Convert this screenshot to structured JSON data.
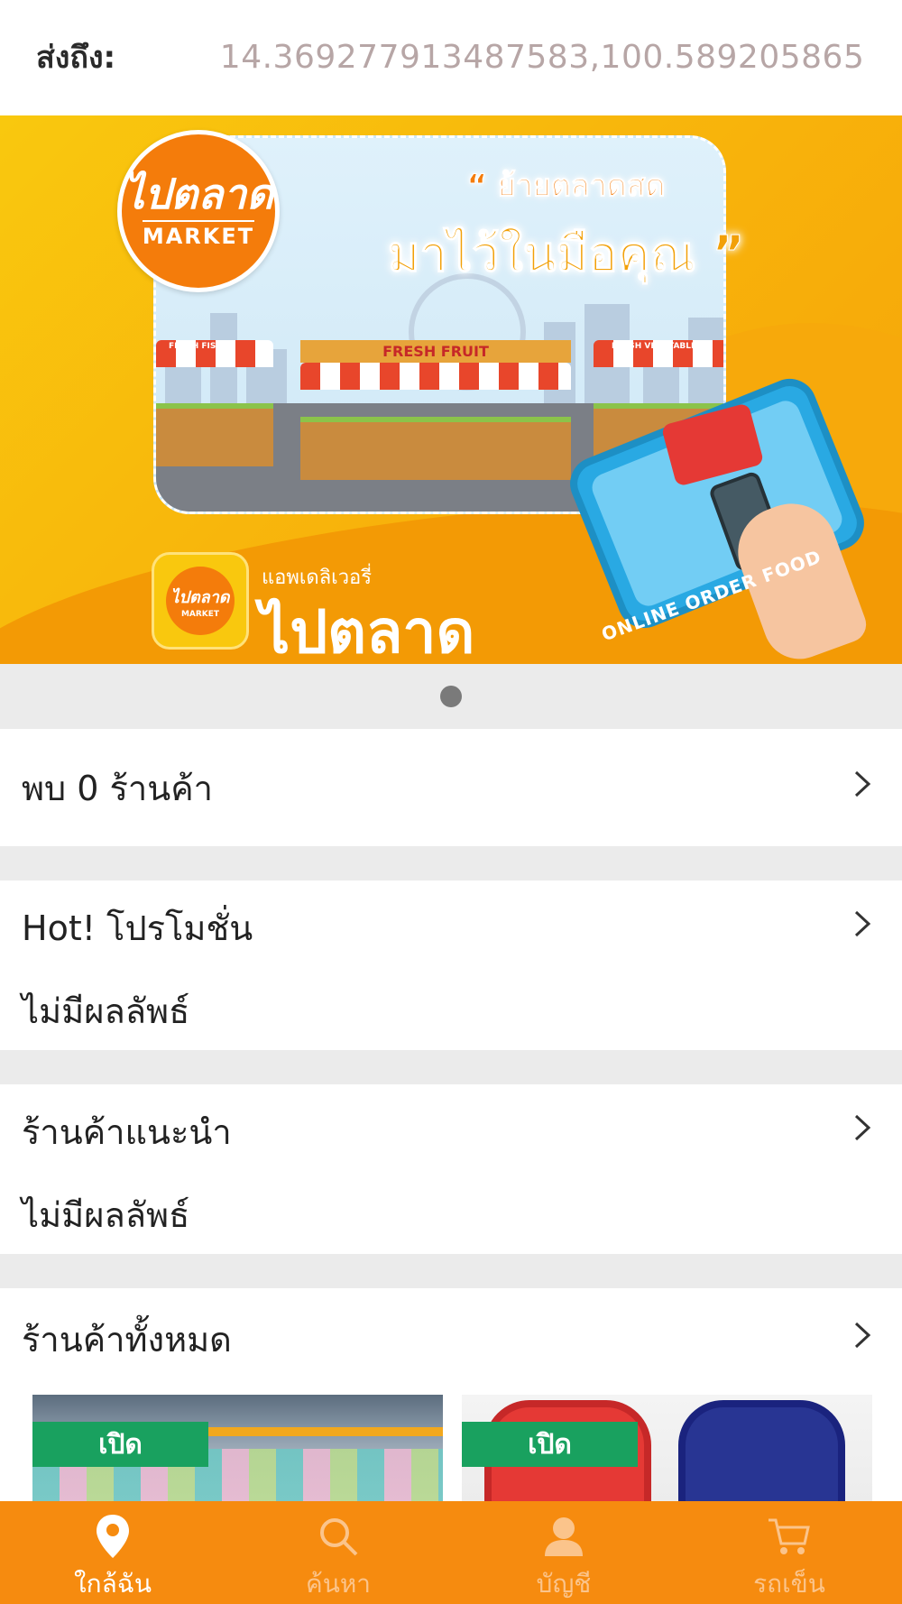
{
  "header": {
    "deliver_label": "ส่งถึง:",
    "coordinates": "14.369277913487583,100.5892058654"
  },
  "banner": {
    "logo_text": "ไปตลาด",
    "logo_sub": "MARKET",
    "slogan_line1": "“ ย้ายตลาดสด",
    "slogan_line2": "มาไว้ในมือคุณ ”",
    "stall_fish": "FRESH FISH",
    "stall_fruit": "FRESH FRUIT",
    "stall_vegetable": "FRESH VEGETABLE",
    "online_text": "ONLINE ORDER FOOD",
    "app_sub": "แอพเดลิเวอรี่",
    "app_name": "ไปตลาด",
    "app_icon_text": "ไปตลาด",
    "app_icon_sub": "MARKET"
  },
  "carousel": {
    "active_index": 0,
    "count": 1
  },
  "sections": {
    "found": {
      "title": "พบ 0 ร้านค้า"
    },
    "promotion": {
      "title": "Hot! โปรโมชั่น",
      "empty": "ไม่มีผลลัพธ์"
    },
    "recommended": {
      "title": "ร้านค้าแนะนำ",
      "empty": "ไม่มีผลลัพธ์"
    },
    "all_stores": {
      "title": "ร้านค้าทั้งหมด"
    }
  },
  "stores": [
    {
      "status": "เปิด"
    },
    {
      "status": "เปิด"
    }
  ],
  "bottom_nav": [
    {
      "label": "ใกล้ฉัน",
      "icon": "location-pin-icon",
      "active": true
    },
    {
      "label": "ค้นหา",
      "icon": "search-icon",
      "active": false
    },
    {
      "label": "บัญชี",
      "icon": "account-icon",
      "active": false
    },
    {
      "label": "รถเข็น",
      "icon": "cart-icon",
      "active": false
    }
  ],
  "colors": {
    "nav_background": "#f68b0f",
    "open_badge": "#19a15f",
    "coordinate_text": "#b7a6a6"
  }
}
